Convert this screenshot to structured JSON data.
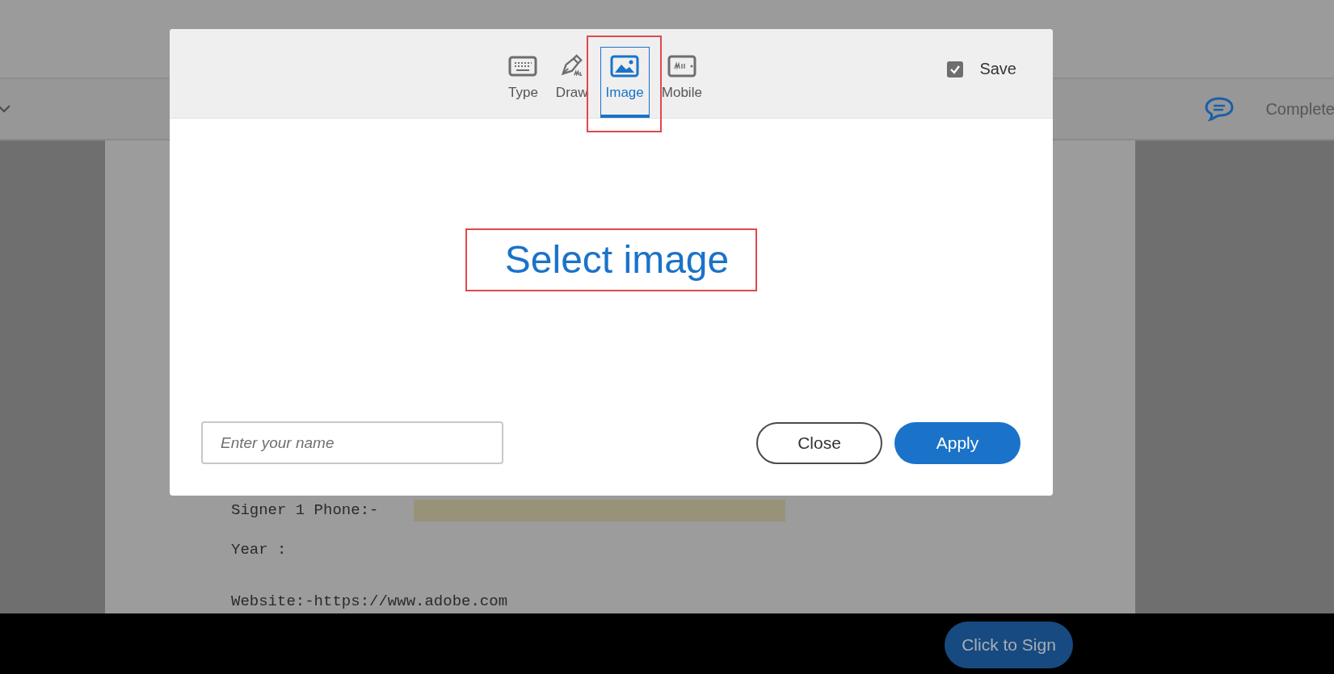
{
  "toolbar": {
    "status": "Complete"
  },
  "document": {
    "lines": [
      {
        "label": "Signer 1 Phone:-",
        "kind": "field"
      },
      {
        "label": "Year :",
        "kind": "text"
      },
      {
        "label": "Website:-https://www.adobe.com",
        "kind": "text"
      }
    ]
  },
  "dialog": {
    "tabs": [
      {
        "label": "Type",
        "selected": false
      },
      {
        "label": "Draw",
        "selected": false
      },
      {
        "label": "Image",
        "selected": true
      },
      {
        "label": "Mobile",
        "selected": false
      }
    ],
    "save": {
      "label": "Save",
      "checked": true
    },
    "select_image": "Select image",
    "name_field": {
      "placeholder": "Enter your name"
    },
    "buttons": [
      {
        "label": "Close",
        "kind": "secondary"
      },
      {
        "label": "Apply",
        "kind": "primary"
      }
    ]
  },
  "footer": {
    "sign_button": "Click to Sign"
  }
}
